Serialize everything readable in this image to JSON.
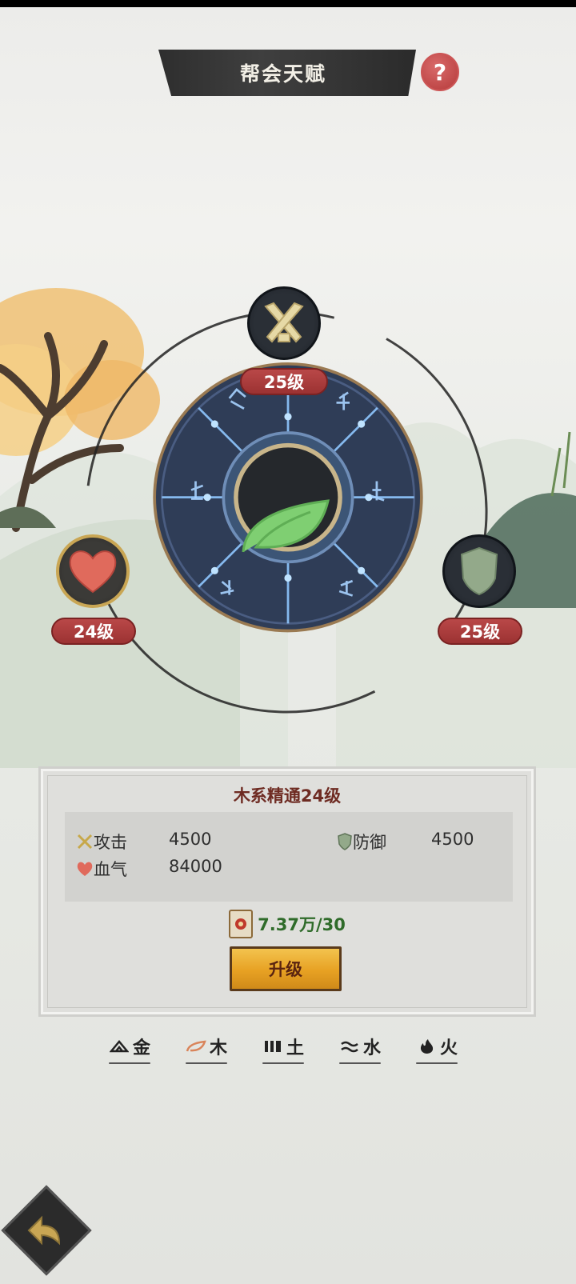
{
  "header": {
    "title": "帮会天赋",
    "help_label": "?"
  },
  "wheel": {
    "center_element": "leaf-icon",
    "nodes": [
      {
        "id": "attack",
        "icon": "crossed-swords-icon",
        "level": "25级"
      },
      {
        "id": "hp",
        "icon": "heart-icon",
        "level": "24级",
        "selected": true
      },
      {
        "id": "defense",
        "icon": "shield-icon",
        "level": "25级"
      }
    ]
  },
  "panel": {
    "title": "木系精通24级",
    "stats": {
      "attack_label": "攻击",
      "attack_value": "4500",
      "defense_label": "防御",
      "defense_value": "4500",
      "hp_label": "血气",
      "hp_value": "84000"
    },
    "cost": "7.37万/30",
    "upgrade_label": "升级"
  },
  "tabs": [
    {
      "label": "金",
      "icon": "metal-icon"
    },
    {
      "label": "木",
      "icon": "wood-icon",
      "active": true
    },
    {
      "label": "土",
      "icon": "earth-icon"
    },
    {
      "label": "水",
      "icon": "water-icon"
    },
    {
      "label": "火",
      "icon": "fire-icon"
    }
  ],
  "colors": {
    "accent_red": "#b94848",
    "leaf_green": "#7fcf72",
    "wheel_blue": "#2f3d57",
    "rune_blue": "#8fc7ff",
    "button_gold": "#e7a123"
  }
}
